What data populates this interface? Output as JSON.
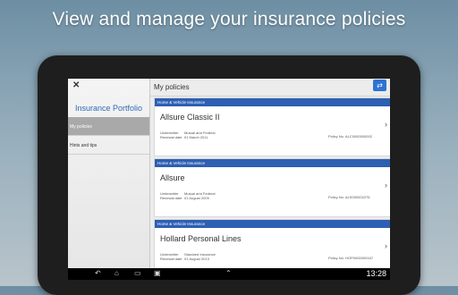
{
  "headline": "View and manage your insurance policies",
  "sidebar": {
    "title": "Insurance Portfolio",
    "items": [
      {
        "label": "My policies",
        "active": true
      },
      {
        "label": "Hints and tips",
        "active": false
      }
    ]
  },
  "main": {
    "title": "My policies",
    "switch_icon": "swap-icon",
    "policies": [
      {
        "category": "Home & Vehicle Insurance",
        "name": "Allsure Classic II",
        "underwriter_label": "Underwriter",
        "underwriter": "Mutual and Federal",
        "renewal_label": "Renewal date",
        "renewal": "01 March 2011",
        "policy_no_label": "Policy No.",
        "policy_no": "ALC0000000002"
      },
      {
        "category": "Home & Vehicle Insurance",
        "name": "Allsure",
        "underwriter_label": "Underwriter",
        "underwriter": "Mutual and Federal",
        "renewal_label": "Renewal date",
        "renewal": "01 August 2009",
        "policy_no_label": "Policy No.",
        "policy_no": "ALS000002276"
      },
      {
        "category": "Home & Vehicle Insurance",
        "name": "Hollard Personal Lines",
        "underwriter_label": "Underwriter",
        "underwriter": "Standard Insurance",
        "renewal_label": "Renewal date",
        "renewal": "01 August 2013",
        "policy_no_label": "Policy No.",
        "policy_no": "HOP0000000167"
      }
    ]
  },
  "navbar": {
    "clock": "13:28",
    "icons": [
      "back-icon",
      "home-icon",
      "recent-apps-icon",
      "screenshot-icon",
      "chevron-up-icon"
    ]
  },
  "colors": {
    "accent": "#2d5fb3",
    "sidebar_title": "#2e6bb5",
    "active_item": "#a9a9a9"
  }
}
